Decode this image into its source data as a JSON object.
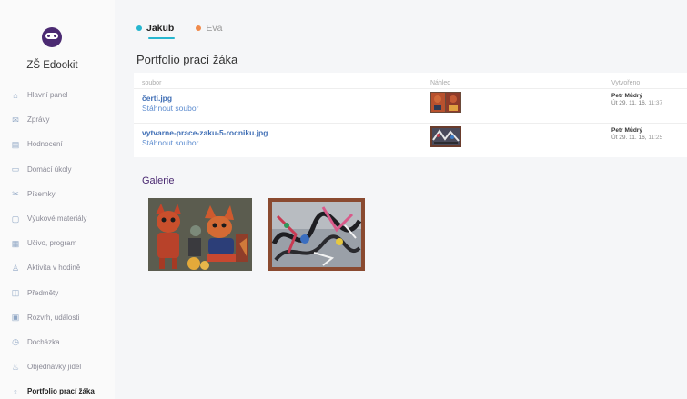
{
  "app": {
    "school_name": "ZŠ Edookit"
  },
  "sidebar": {
    "items": [
      {
        "label": "Hlavní panel",
        "icon": "home-icon"
      },
      {
        "label": "Zprávy",
        "icon": "messages-icon"
      },
      {
        "label": "Hodnocení",
        "icon": "grades-icon"
      },
      {
        "label": "Domácí úkoly",
        "icon": "homework-icon"
      },
      {
        "label": "Písemky",
        "icon": "tests-icon"
      },
      {
        "label": "Výukové materiály",
        "icon": "materials-icon"
      },
      {
        "label": "Učivo, program",
        "icon": "curriculum-icon"
      },
      {
        "label": "Aktivita v hodině",
        "icon": "activity-icon"
      },
      {
        "label": "Předměty",
        "icon": "subjects-icon"
      },
      {
        "label": "Rozvrh, události",
        "icon": "calendar-icon"
      },
      {
        "label": "Docházka",
        "icon": "attendance-icon"
      },
      {
        "label": "Objednávky jídel",
        "icon": "meals-icon"
      },
      {
        "label": "Portfolio prací žáka",
        "icon": "portfolio-icon",
        "active": true
      }
    ]
  },
  "tabs": [
    {
      "label": "Jakub",
      "color": "#26b6cf",
      "active": true
    },
    {
      "label": "Eva",
      "color": "#f08a4b",
      "active": false
    }
  ],
  "page": {
    "title": "Portfolio prací žáka"
  },
  "table": {
    "headers": {
      "file": "soubor",
      "preview": "Náhled",
      "created": "Vytvořeno"
    },
    "rows": [
      {
        "filename": "čerti.jpg",
        "download": "Stáhnout soubor",
        "author": "Petr Můdrý",
        "date": "Út 29. 11. 16,",
        "time": "11:37"
      },
      {
        "filename": "vytvarne-prace-zaku-5-rocniku.jpg",
        "download": "Stáhnout soubor",
        "author": "Petr Můdrý",
        "date": "Út 29. 11. 16,",
        "time": "11:25"
      }
    ]
  },
  "gallery": {
    "title": "Galerie"
  },
  "colors": {
    "accent": "#26b6cf",
    "brand": "#4b2a72",
    "link": "#3f6eb5",
    "secondary": "#f08a4b"
  }
}
